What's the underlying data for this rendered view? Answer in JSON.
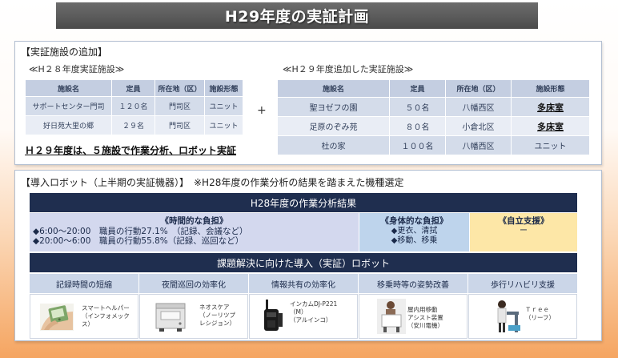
{
  "title": "H29年度の実証計画",
  "facilities": {
    "heading": "【実証施設の追加】",
    "h28": {
      "caption": "≪H２８年度実証施設≫",
      "headers": [
        "施設名",
        "定員",
        "所在地（区）",
        "施設形態"
      ],
      "rows": [
        [
          "サポートセンター門司",
          "１２０名",
          "門司区",
          "ユニット"
        ],
        [
          "好日苑大里の郷",
          "２９名",
          "門司区",
          "ユニット"
        ]
      ]
    },
    "plus": "+",
    "h29": {
      "caption": "≪H２９年度追加した実証施設≫",
      "headers": [
        "施設名",
        "定員",
        "所在地（区）",
        "施設形態"
      ],
      "rows": [
        [
          "聖ヨゼフの園",
          "５０名",
          "八幡西区",
          "多床室"
        ],
        [
          "足原のぞみ苑",
          "８０名",
          "小倉北区",
          "多床室"
        ],
        [
          "杜の家",
          "１００名",
          "八幡西区",
          "ユニット"
        ]
      ]
    },
    "summary": "Ｈ２９年度は、５施設で作業分析、ロボット実証"
  },
  "robots": {
    "heading": "【導入ロボット（上半期の実証機器）】　※H28年度の作業分析の結果を踏まえた機種選定",
    "analysis_title": "H28年度の作業分析結果",
    "time_burden": {
      "title": "《時間的な負担》",
      "lines": [
        "◆6:00～20:00　職員の行動27.1%　（記録、会議など）",
        "◆20:00～6:00　職員の行動55.8%（記録、巡回など）"
      ]
    },
    "physical_burden": {
      "title": "《身体的な負担》",
      "lines": [
        "◆更衣、清拭",
        "◆移動、移乗"
      ]
    },
    "independence": {
      "title": "《自立支援》",
      "lines": [
        "ー"
      ]
    },
    "solution_title": "課題解決に向けた導入（実証）ロボット",
    "items": [
      {
        "category": "記録時間の短縮",
        "caption": [
          "スマートヘルパー",
          "（インフォメック",
          "ス）"
        ],
        "image": "smart-helper-photo"
      },
      {
        "category": "夜間巡回の効率化",
        "caption": [
          "ネオスケア",
          "（ノーリツプ",
          "レシジョン）"
        ],
        "image": "neoscare-sensor-photo"
      },
      {
        "category": "情報共有の効率化",
        "caption": [
          "インカムDJ-P221",
          "（M）",
          "（アルインコ）"
        ],
        "image": "intercom-radio-photo"
      },
      {
        "category": "移乗時等の姿勢改善",
        "caption": [
          "屋内用移動",
          "アシスト装置",
          "（安川電機）"
        ],
        "image": "mobility-assist-photo"
      },
      {
        "category": "歩行リハビリ支援",
        "caption": [
          "Ｔｒｅｅ",
          "（リーフ）"
        ],
        "image": "walking-rehab-photo"
      }
    ]
  },
  "colors": {
    "title_bar": "#5b5b5b",
    "navy": "#1f2e4f",
    "table_header": "#c4cee1",
    "row_dark": "#d4dcea",
    "row_light": "#e9edf5",
    "time_burden": "#d3d8ee",
    "physical_burden": "#bed4ec",
    "independence": "#fde7a7",
    "category_header": "#cbd6e8",
    "accent_orange": "#f5a561"
  }
}
